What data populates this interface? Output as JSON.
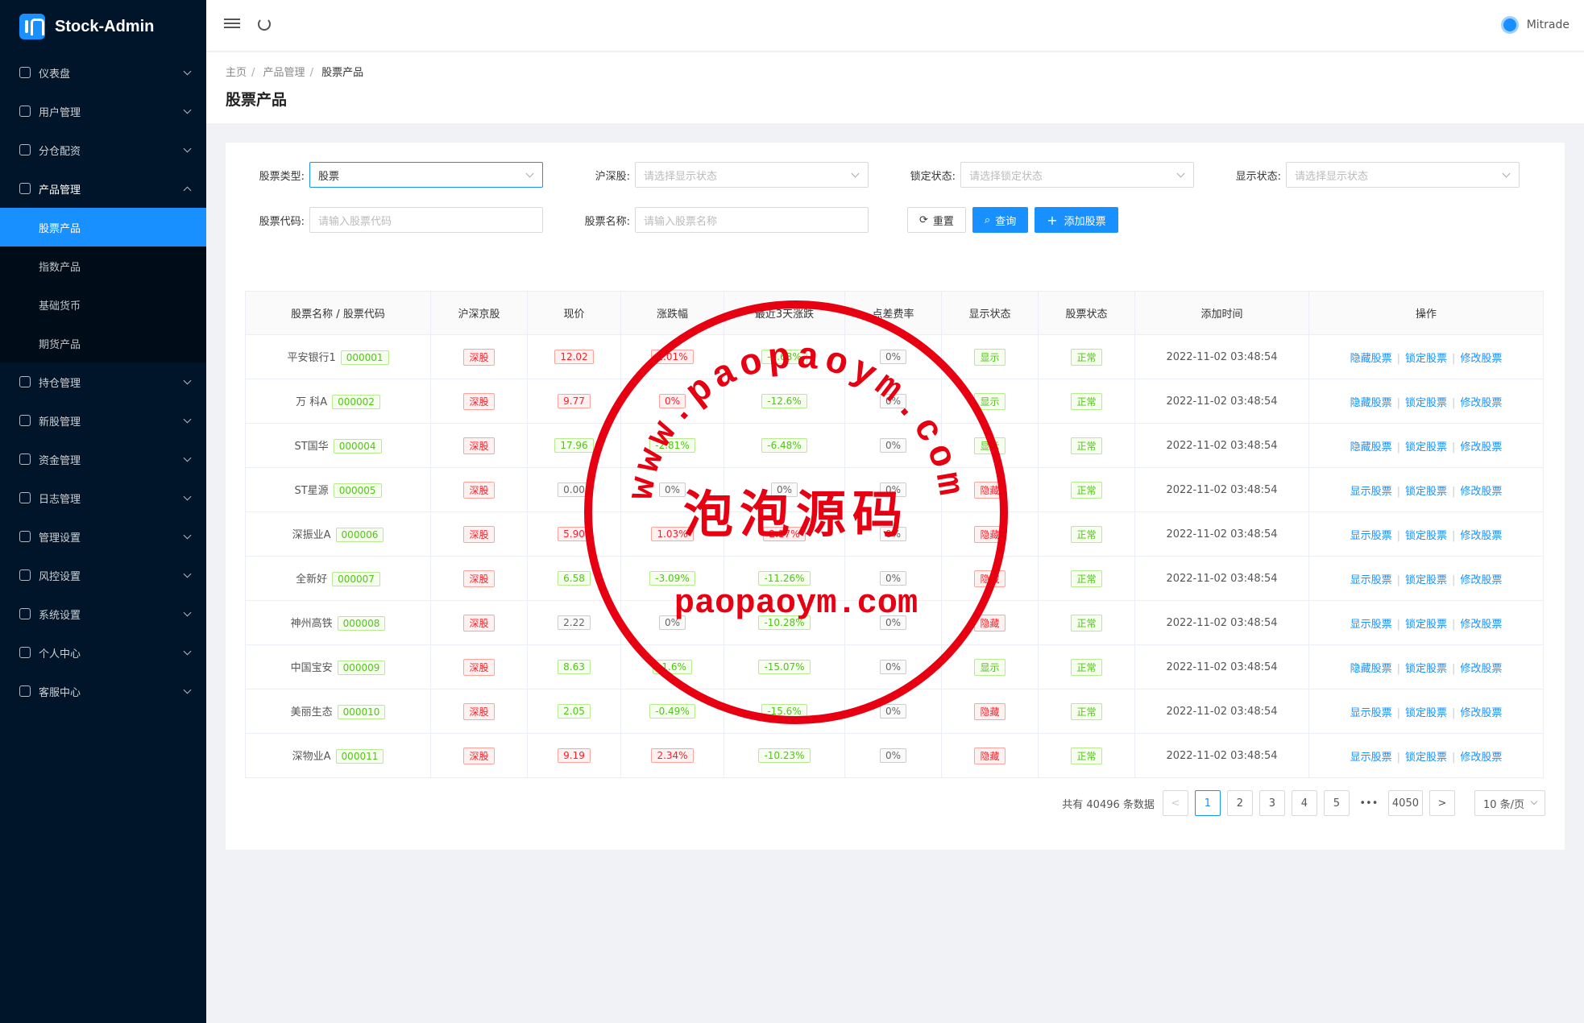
{
  "app": {
    "name": "Stock-Admin"
  },
  "sidebar": {
    "items": [
      {
        "label": "仪表盘",
        "icon": "dashboard-icon"
      },
      {
        "label": "用户管理",
        "icon": "user-icon"
      },
      {
        "label": "分仓配资",
        "icon": "cluster-icon"
      },
      {
        "label": "产品管理",
        "icon": "chart-icon",
        "open": true,
        "children": [
          "股票产品",
          "指数产品",
          "基础货币",
          "期货产品"
        ],
        "active_child": "股票产品"
      },
      {
        "label": "持仓管理",
        "icon": "position-icon"
      },
      {
        "label": "新股管理",
        "icon": "ipo-icon"
      },
      {
        "label": "资金管理",
        "icon": "money-icon"
      },
      {
        "label": "日志管理",
        "icon": "log-icon"
      },
      {
        "label": "管理设置",
        "icon": "admin-icon"
      },
      {
        "label": "风控设置",
        "icon": "warning-icon"
      },
      {
        "label": "系统设置",
        "icon": "gear-icon"
      },
      {
        "label": "个人中心",
        "icon": "person-icon"
      },
      {
        "label": "客服中心",
        "icon": "headset-icon"
      }
    ]
  },
  "header": {
    "user": "Mitrade"
  },
  "breadcrumb": [
    "主页",
    "产品管理",
    "股票产品"
  ],
  "page_title": "股票产品",
  "filters": {
    "stock_type": {
      "label": "股票类型:",
      "value": "股票"
    },
    "sh_sz": {
      "label": "沪深股:",
      "placeholder": "请选择显示状态"
    },
    "lock_status": {
      "label": "锁定状态:",
      "placeholder": "请选择锁定状态"
    },
    "display_status": {
      "label": "显示状态:",
      "placeholder": "请选择显示状态"
    },
    "stock_code": {
      "label": "股票代码:",
      "placeholder": "请输入股票代码"
    },
    "stock_name": {
      "label": "股票名称:",
      "placeholder": "请输入股票名称"
    },
    "reset_label": "重置",
    "search_label": "查询",
    "add_label": "添加股票"
  },
  "table": {
    "columns": [
      "股票名称 / 股票代码",
      "沪深京股",
      "现价",
      "涨跌幅",
      "最近3天涨跌",
      "点差费率",
      "显示状态",
      "股票状态",
      "添加时间",
      "操作"
    ],
    "rows": [
      {
        "name": "平安银行1",
        "code": "000001",
        "market": "深股",
        "price": "12.02",
        "price_dir": "up",
        "change": "1.01%",
        "change_dir": "up",
        "three_day": "-6.68%",
        "three_dir": "down",
        "spread": "0%",
        "display": "显示",
        "status": "正常",
        "time": "2022-11-02 03:48:54",
        "toggle": "隐藏股票"
      },
      {
        "name": "万 科A",
        "code": "000002",
        "market": "深股",
        "price": "9.77",
        "price_dir": "up",
        "change": "0%",
        "change_dir": "up",
        "three_day": "-12.6%",
        "three_dir": "down",
        "spread": "0%",
        "display": "显示",
        "status": "正常",
        "time": "2022-11-02 03:48:54",
        "toggle": "隐藏股票"
      },
      {
        "name": "ST国华",
        "code": "000004",
        "market": "深股",
        "price": "17.96",
        "price_dir": "down",
        "change": "-2.81%",
        "change_dir": "down",
        "three_day": "-6.48%",
        "three_dir": "down",
        "spread": "0%",
        "display": "显示",
        "status": "正常",
        "time": "2022-11-02 03:48:54",
        "toggle": "隐藏股票"
      },
      {
        "name": "ST星源",
        "code": "000005",
        "market": "深股",
        "price": "0.00",
        "price_dir": "flat",
        "change": "0%",
        "change_dir": "flat",
        "three_day": "0%",
        "three_dir": "flat",
        "spread": "0%",
        "display": "隐藏",
        "status": "正常",
        "time": "2022-11-02 03:48:54",
        "toggle": "显示股票"
      },
      {
        "name": "深振业A",
        "code": "000006",
        "market": "深股",
        "price": "5.90",
        "price_dir": "up",
        "change": "1.03%",
        "change_dir": "up",
        "three_day": "2.17%",
        "three_dir": "up",
        "spread": "0%",
        "display": "隐藏",
        "status": "正常",
        "time": "2022-11-02 03:48:54",
        "toggle": "显示股票"
      },
      {
        "name": "全新好",
        "code": "000007",
        "market": "深股",
        "price": "6.58",
        "price_dir": "down",
        "change": "-3.09%",
        "change_dir": "down",
        "three_day": "-11.26%",
        "three_dir": "down",
        "spread": "0%",
        "display": "隐藏",
        "status": "正常",
        "time": "2022-11-02 03:48:54",
        "toggle": "显示股票"
      },
      {
        "name": "神州高铁",
        "code": "000008",
        "market": "深股",
        "price": "2.22",
        "price_dir": "flat",
        "change": "0%",
        "change_dir": "flat",
        "three_day": "-10.28%",
        "three_dir": "down",
        "spread": "0%",
        "display": "隐藏",
        "status": "正常",
        "time": "2022-11-02 03:48:54",
        "toggle": "显示股票"
      },
      {
        "name": "中国宝安",
        "code": "000009",
        "market": "深股",
        "price": "8.63",
        "price_dir": "down",
        "change": "-1.6%",
        "change_dir": "down",
        "three_day": "-15.07%",
        "three_dir": "down",
        "spread": "0%",
        "display": "显示",
        "status": "正常",
        "time": "2022-11-02 03:48:54",
        "toggle": "隐藏股票"
      },
      {
        "name": "美丽生态",
        "code": "000010",
        "market": "深股",
        "price": "2.05",
        "price_dir": "down",
        "change": "-0.49%",
        "change_dir": "down",
        "three_day": "-15.6%",
        "three_dir": "down",
        "spread": "0%",
        "display": "隐藏",
        "status": "正常",
        "time": "2022-11-02 03:48:54",
        "toggle": "显示股票"
      },
      {
        "name": "深物业A",
        "code": "000011",
        "market": "深股",
        "price": "9.19",
        "price_dir": "up",
        "change": "2.34%",
        "change_dir": "up",
        "three_day": "-10.23%",
        "three_dir": "down",
        "spread": "0%",
        "display": "隐藏",
        "status": "正常",
        "time": "2022-11-02 03:48:54",
        "toggle": "显示股票"
      }
    ],
    "lock_label": "锁定股票",
    "edit_label": "修改股票"
  },
  "pagination": {
    "total_text": "共有 40496 条数据",
    "pages": [
      "1",
      "2",
      "3",
      "4",
      "5",
      "•••",
      "4050"
    ],
    "current": "1",
    "page_size": "10 条/页"
  },
  "watermark": {
    "url_text": "www.paopaoym.com",
    "cn_text": "泡泡源码",
    "bottom_text": "paopaoym.com"
  },
  "colors": {
    "sidebar_bg": "#001529",
    "accent": "#1890ff",
    "red": "#f5222d",
    "green": "#52c41a",
    "stamp": "#e60012"
  }
}
